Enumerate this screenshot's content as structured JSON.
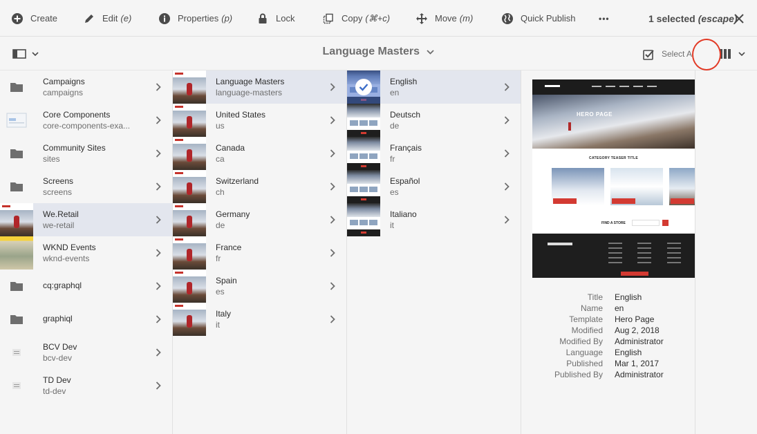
{
  "toolbar": {
    "actions": [
      {
        "label": "Create",
        "hint": ""
      },
      {
        "label": "Edit",
        "hint": "(e)"
      },
      {
        "label": "Properties",
        "hint": "(p)"
      },
      {
        "label": "Lock",
        "hint": ""
      },
      {
        "label": "Copy",
        "hint": "(⌘+c)"
      },
      {
        "label": "Move",
        "hint": "(m)"
      },
      {
        "label": "Quick Publish",
        "hint": ""
      }
    ],
    "more_label": "•••",
    "selection_count": "1 selected",
    "selection_hint": "(escape)"
  },
  "titlebar": {
    "location": "Language Masters",
    "select_all": "Select All"
  },
  "columns": {
    "sites": [
      {
        "title": "Campaigns",
        "name": "campaigns",
        "thumb": "folder"
      },
      {
        "title": "Core Components",
        "name": "core-components-exa...",
        "thumb": "template"
      },
      {
        "title": "Community Sites",
        "name": "sites",
        "thumb": "folder"
      },
      {
        "title": "Screens",
        "name": "screens",
        "thumb": "folder"
      },
      {
        "title": "We.Retail",
        "name": "we-retail",
        "thumb": "page",
        "active": true
      },
      {
        "title": "WKND Events",
        "name": "wknd-events",
        "thumb": "wknd"
      },
      {
        "title": "cq:graphql",
        "name": "",
        "thumb": "folder"
      },
      {
        "title": "graphiql",
        "name": "",
        "thumb": "folder"
      },
      {
        "title": "BCV Dev",
        "name": "bcv-dev",
        "thumb": "doc"
      },
      {
        "title": "TD Dev",
        "name": "td-dev",
        "thumb": "doc"
      }
    ],
    "we_retail": [
      {
        "title": "Language Masters",
        "name": "language-masters",
        "active": true
      },
      {
        "title": "United States",
        "name": "us"
      },
      {
        "title": "Canada",
        "name": "ca"
      },
      {
        "title": "Switzerland",
        "name": "ch"
      },
      {
        "title": "Germany",
        "name": "de"
      },
      {
        "title": "France",
        "name": "fr"
      },
      {
        "title": "Spain",
        "name": "es"
      },
      {
        "title": "Italy",
        "name": "it"
      }
    ],
    "languages": [
      {
        "title": "English",
        "name": "en",
        "active": true,
        "selected": true
      },
      {
        "title": "Deutsch",
        "name": "de"
      },
      {
        "title": "Français",
        "name": "fr"
      },
      {
        "title": "Español",
        "name": "es"
      },
      {
        "title": "Italiano",
        "name": "it"
      }
    ]
  },
  "preview": {
    "hero_text": "HERO PAGE",
    "category_text": "CATEGORY TEASER TITLE",
    "find_store_text": "FIND A STORE",
    "properties": [
      {
        "key": "Title",
        "value": "English"
      },
      {
        "key": "Name",
        "value": "en"
      },
      {
        "key": "Template",
        "value": "Hero Page"
      },
      {
        "key": "Modified",
        "value": "Aug 2, 2018"
      },
      {
        "key": "Modified By",
        "value": "Administrator"
      },
      {
        "key": "Language",
        "value": "English"
      },
      {
        "key": "Published",
        "value": "Mar 1, 2017"
      },
      {
        "key": "Published By",
        "value": "Administrator"
      }
    ]
  },
  "colors": {
    "highlight_ring": "#e23a26",
    "active_row": "#e3e6ee",
    "brand_red": "#d33a32"
  }
}
